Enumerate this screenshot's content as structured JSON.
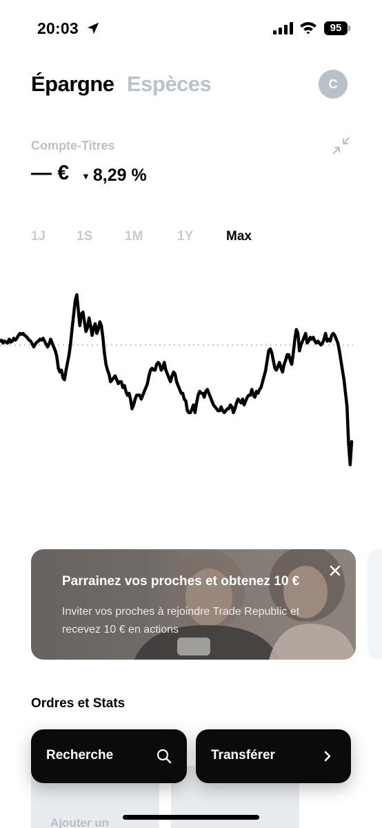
{
  "status_bar": {
    "time": "20:03",
    "battery": "95",
    "icons": [
      "location-arrow-icon",
      "cellular-signal-icon",
      "wifi-icon",
      "battery-icon"
    ]
  },
  "header": {
    "tabs": [
      {
        "label": "Épargne",
        "active": true
      },
      {
        "label": "Espèces",
        "active": false
      }
    ],
    "avatar_initial": "C"
  },
  "account": {
    "label": "Compte-Titres",
    "value": "— €",
    "change": "8,29 %",
    "change_direction": "down",
    "collapse_icon": "collapse-arrows-icon"
  },
  "ranges": {
    "items": [
      "1J",
      "1S",
      "1M",
      "1Y",
      "Max"
    ],
    "active": "Max"
  },
  "chart_data": {
    "type": "line",
    "series": [
      {
        "values": [
          0.2,
          0.25,
          0.1,
          0.2,
          0.15,
          0.1,
          0.3,
          0.15,
          0.2,
          0.35,
          0.25,
          0.35,
          0.5,
          0.6,
          0.55,
          0.6,
          0.5,
          0.45,
          0.35,
          0.25,
          0.2,
          0.05,
          -0.1,
          0.05,
          0.15,
          0.2,
          0.3,
          0.25,
          0.35,
          0.2,
          0.05,
          -0.1,
          0.05,
          0.3,
          0.1,
          -0.1,
          -0.3,
          -0.6,
          -1.2,
          -1.4,
          -1.3,
          -1.7,
          -1.8,
          -1.3,
          -0.9,
          -0.5,
          0.1,
          0.9,
          1.6,
          2.3,
          2.6,
          1.8,
          1.0,
          1.6,
          1.7,
          1.2,
          0.7,
          0.9,
          1.4,
          1.0,
          0.5,
          0.9,
          1.1,
          0.6,
          0.8,
          1.2,
          1.0,
          0.4,
          -0.4,
          -1.0,
          -1.3,
          -1.5,
          -1.9,
          -1.8,
          -1.7,
          -1.6,
          -1.8,
          -2.0,
          -1.9,
          -1.9,
          -2.2,
          -2.1,
          -2.4,
          -2.6,
          -2.5,
          -2.8,
          -3.3,
          -3.1,
          -2.8,
          -2.6,
          -2.6,
          -2.6,
          -2.8,
          -2.6,
          -2.4,
          -2.2,
          -2.0,
          -1.6,
          -1.3,
          -1.2,
          -1.3,
          -1.3,
          -1.0,
          -0.9,
          -1.0,
          -1.3,
          -1.2,
          -0.9,
          -1.3,
          -1.5,
          -1.7,
          -1.9,
          -1.6,
          -1.4,
          -1.5,
          -1.9,
          -2.1,
          -2.3,
          -2.5,
          -2.5,
          -2.8,
          -2.9,
          -3.4,
          -3.5,
          -3.5,
          -3.3,
          -3.1,
          -3.5,
          -3.0,
          -2.6,
          -2.4,
          -2.5,
          -2.5,
          -2.7,
          -2.4,
          -2.3,
          -2.5,
          -2.7,
          -2.9,
          -3.1,
          -3.2,
          -3.3,
          -3.4,
          -3.4,
          -3.2,
          -3.4,
          -3.5,
          -3.4,
          -3.3,
          -3.3,
          -3.1,
          -3.2,
          -3.5,
          -3.3,
          -3.0,
          -2.8,
          -2.9,
          -3.0,
          -2.8,
          -3.1,
          -2.9,
          -2.7,
          -2.6,
          -2.6,
          -2.3,
          -2.6,
          -2.7,
          -2.4,
          -2.5,
          -2.3,
          -2.2,
          -1.9,
          -1.6,
          -1.3,
          -0.8,
          -0.3,
          -0.2,
          -0.4,
          -0.8,
          -1.2,
          -1.3,
          -1.1,
          -0.9,
          -1.2,
          -1.4,
          -1.0,
          -0.8,
          -0.5,
          -0.5,
          -0.8,
          -1.0,
          -0.4,
          0.3,
          0.8,
          0.6,
          -0.3,
          0.0,
          0.2,
          0.4,
          0.6,
          0.1,
          0.2,
          0.4,
          0.3,
          0.4,
          0.2,
          0.1,
          0.2,
          0.1,
          0.0,
          0.1,
          0.3,
          0.6,
          0.2,
          0.3,
          0.2,
          0.5,
          0.6,
          0.5,
          0.3,
          0.1,
          -0.3,
          -0.8,
          -1.3,
          -1.8,
          -2.5,
          -3.2,
          -5.1,
          -6.2,
          -5.0
        ]
      }
    ],
    "reference_line": 0,
    "grid": false
  },
  "promo": {
    "title": "Parrainez vos proches et obtenez 10  €",
    "text": "Inviter vos proches à rejoindre Trade Republic et recevez 10 € en actions",
    "close_icon": "close-icon"
  },
  "section": {
    "title": "Ordres et Stats",
    "card_text": "Ajouter un"
  },
  "actions": {
    "search_label": "Recherche",
    "search_icon": "search-icon",
    "transfer_label": "Transférer",
    "transfer_icon": "chevron-right-icon"
  },
  "colors": {
    "muted": "#b9c2ca",
    "dark_button": "#0b0b0b",
    "avatar": "#b8c0c8"
  }
}
